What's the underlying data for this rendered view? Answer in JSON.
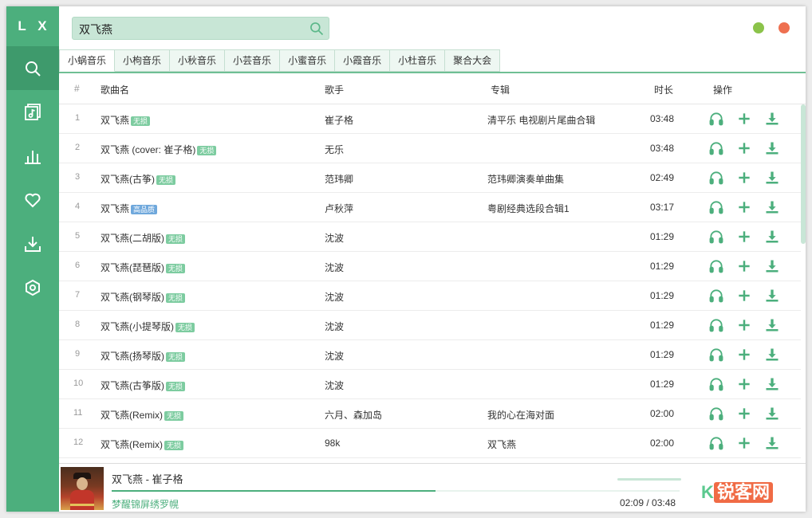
{
  "app": {
    "logo": "L X"
  },
  "sidebar": {
    "items": [
      {
        "icon": "search-icon"
      },
      {
        "icon": "songlist-icon"
      },
      {
        "icon": "leaderboard-icon"
      },
      {
        "icon": "favorite-heart-icon"
      },
      {
        "icon": "download-icon"
      },
      {
        "icon": "settings-icon"
      }
    ]
  },
  "search": {
    "value": "双飞燕"
  },
  "tabs": [
    "小蜗音乐",
    "小枸音乐",
    "小秋音乐",
    "小芸音乐",
    "小蜜音乐",
    "小霞音乐",
    "小杜音乐",
    "聚合大会"
  ],
  "table": {
    "headers": {
      "num": "#",
      "name": "歌曲名",
      "singer": "歌手",
      "album": "专辑",
      "duration": "时长",
      "ops": "操作"
    },
    "rows": [
      {
        "num": "1",
        "name": "双飞燕",
        "badge": "无损",
        "singer": "崔子格",
        "album": "清平乐 电视剧片尾曲合辑",
        "duration": "03:48"
      },
      {
        "num": "2",
        "name": "双飞燕 (cover: 崔子格)",
        "badge": "无损",
        "singer": "无乐",
        "album": "",
        "duration": "03:48"
      },
      {
        "num": "3",
        "name": "双飞燕(古筝)",
        "badge": "无损",
        "singer": "范玮卿",
        "album": "范玮卿演奏单曲集",
        "duration": "02:49"
      },
      {
        "num": "4",
        "name": "双飞燕",
        "badge": "高品质",
        "singer": "卢秋萍",
        "album": "粤剧经典选段合辑1",
        "duration": "03:17"
      },
      {
        "num": "5",
        "name": "双飞燕(二胡版)",
        "badge": "无损",
        "singer": "沈波",
        "album": "",
        "duration": "01:29"
      },
      {
        "num": "6",
        "name": "双飞燕(琵琶版)",
        "badge": "无损",
        "singer": "沈波",
        "album": "",
        "duration": "01:29"
      },
      {
        "num": "7",
        "name": "双飞燕(钢琴版)",
        "badge": "无损",
        "singer": "沈波",
        "album": "",
        "duration": "01:29"
      },
      {
        "num": "8",
        "name": "双飞燕(小提琴版)",
        "badge": "无损",
        "singer": "沈波",
        "album": "",
        "duration": "01:29"
      },
      {
        "num": "9",
        "name": "双飞燕(扬琴版)",
        "badge": "无损",
        "singer": "沈波",
        "album": "",
        "duration": "01:29"
      },
      {
        "num": "10",
        "name": "双飞燕(古筝版)",
        "badge": "无损",
        "singer": "沈波",
        "album": "",
        "duration": "01:29"
      },
      {
        "num": "11",
        "name": "双飞燕(Remix)",
        "badge": "无损",
        "singer": "六月、森加岛",
        "album": "我的心在海对面",
        "duration": "02:00"
      },
      {
        "num": "12",
        "name": "双飞燕(Remix)",
        "badge": "无损",
        "singer": "98k",
        "album": "双飞燕",
        "duration": "02:00"
      }
    ]
  },
  "player": {
    "title": "双飞燕 - 崔子格",
    "lyric": "梦醒锦屏绣罗幌",
    "time": "02:09 / 03:48",
    "progress": 0.57
  },
  "watermark": {
    "text": "锐客网"
  },
  "colors": {
    "accent": "#4caf7d",
    "minimize": "#8bc34a",
    "close": "#ee7050"
  }
}
